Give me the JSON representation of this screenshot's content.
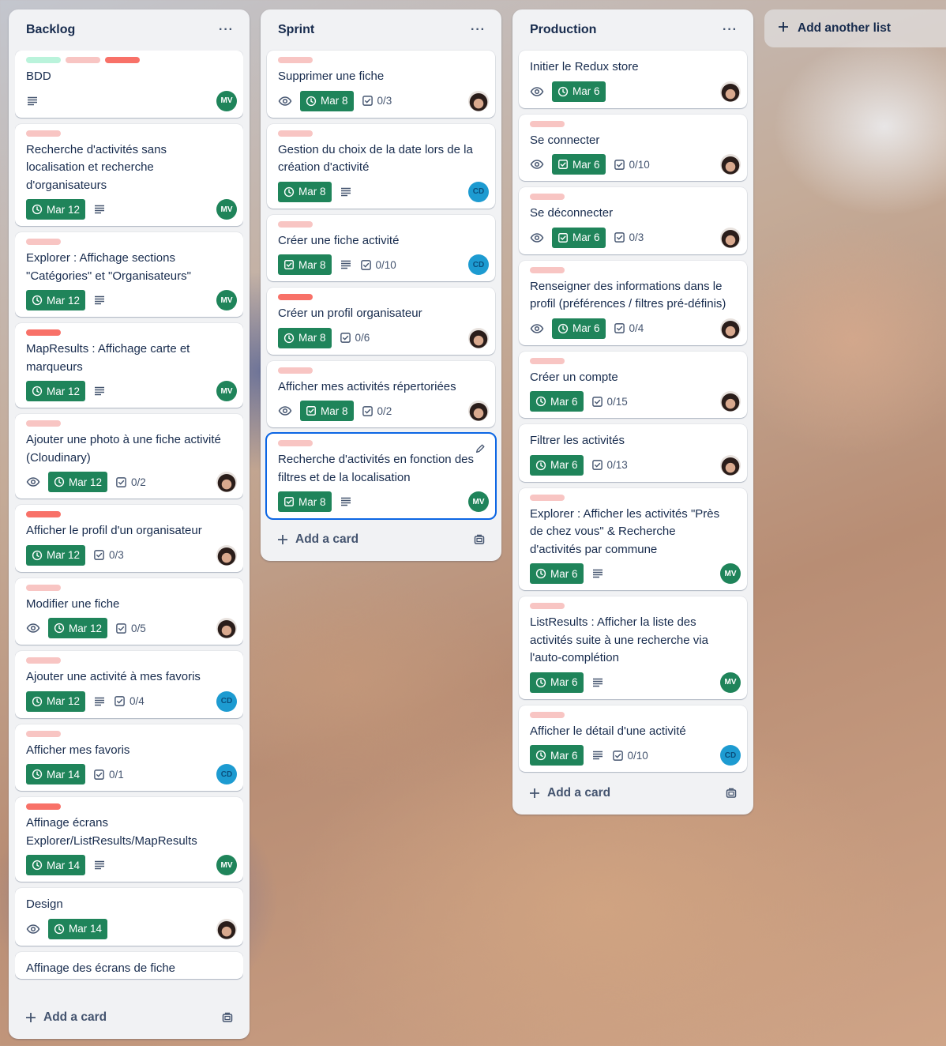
{
  "colors": {
    "label_light_pink": "#f8c5c3",
    "label_red": "#f87168",
    "label_green": "#baf3db",
    "due_green": "#1f845a",
    "avatar_mv": "#1f845a",
    "avatar_cd": "#1d9bd1",
    "selected_outline": "#0c66e4"
  },
  "board": {
    "add_another_list": "Add another list",
    "lists": [
      {
        "title": "Backlog",
        "menu": "···",
        "add_card": "Add a card",
        "cards": [
          {
            "labels": [
              "green",
              "light_pink",
              "red"
            ],
            "title": "BDD",
            "description": true,
            "avatar": "MV"
          },
          {
            "labels": [
              "light_pink"
            ],
            "title": "Recherche d'activités sans localisation et recherche d'organisateurs",
            "due": "Mar 12",
            "description": true,
            "avatar": "MV"
          },
          {
            "labels": [
              "light_pink"
            ],
            "title": "Explorer : Affichage sections \"Catégories\" et \"Organisateurs\"",
            "due": "Mar 12",
            "description": true,
            "avatar": "MV"
          },
          {
            "labels": [
              "red"
            ],
            "title": "MapResults : Affichage carte et marqueurs",
            "due": "Mar 12",
            "description": true,
            "avatar": "MV"
          },
          {
            "labels": [
              "light_pink"
            ],
            "title": "Ajouter une photo à une fiche activité (Cloudinary)",
            "watch": true,
            "due": "Mar 12",
            "checklist": "0/2",
            "avatar": "photo"
          },
          {
            "labels": [
              "red"
            ],
            "title": "Afficher le profil d'un organisateur",
            "due": "Mar 12",
            "checklist": "0/3",
            "avatar": "photo"
          },
          {
            "labels": [
              "light_pink"
            ],
            "title": "Modifier une fiche",
            "watch": true,
            "due": "Mar 12",
            "checklist": "0/5",
            "avatar": "photo"
          },
          {
            "labels": [
              "light_pink"
            ],
            "title": "Ajouter une activité à mes favoris",
            "due": "Mar 12",
            "description": true,
            "checklist": "0/4",
            "avatar": "CD"
          },
          {
            "labels": [
              "light_pink"
            ],
            "title": "Afficher mes favoris",
            "due": "Mar 14",
            "checklist": "0/1",
            "avatar": "CD"
          },
          {
            "labels": [
              "red"
            ],
            "title": "Affinage écrans Explorer/ListResults/MapResults",
            "due": "Mar 14",
            "description": true,
            "avatar": "MV"
          },
          {
            "labels": [],
            "title": "Design",
            "watch": true,
            "due": "Mar 14",
            "avatar": "photo"
          },
          {
            "labels": [],
            "title": "Affinage des écrans de fiche",
            "cut": true
          }
        ]
      },
      {
        "title": "Sprint",
        "menu": "···",
        "add_card": "Add a card",
        "cards": [
          {
            "labels": [
              "light_pink"
            ],
            "title": "Supprimer une fiche",
            "watch": true,
            "due": "Mar 8",
            "due_icon": "clock",
            "checklist": "0/3",
            "avatar": "photo"
          },
          {
            "labels": [
              "light_pink"
            ],
            "title": "Gestion du choix de la date lors de la création d'activité",
            "due": "Mar 8",
            "due_icon": "clock",
            "description": true,
            "avatar": "CD"
          },
          {
            "labels": [
              "light_pink"
            ],
            "title": "Créer une fiche activité",
            "due": "Mar 8",
            "due_icon": "check",
            "description": true,
            "checklist": "0/10",
            "avatar": "CD"
          },
          {
            "labels": [
              "red"
            ],
            "title": "Créer un profil organisateur",
            "due": "Mar 8",
            "due_icon": "clock",
            "checklist": "0/6",
            "avatar": "photo"
          },
          {
            "labels": [
              "light_pink"
            ],
            "title": "Afficher mes activités répertoriées",
            "watch": true,
            "due": "Mar 8",
            "due_icon": "check",
            "checklist": "0/2",
            "avatar": "photo"
          },
          {
            "labels": [
              "light_pink"
            ],
            "title": "Recherche d'activités en fonction des filtres et de la localisation",
            "due": "Mar 8",
            "due_icon": "check",
            "description": true,
            "avatar": "MV",
            "selected": true
          }
        ]
      },
      {
        "title": "Production",
        "menu": "···",
        "add_card": "Add a card",
        "cards": [
          {
            "labels": [],
            "title": "Initier le Redux store",
            "watch": true,
            "due": "Mar 6",
            "due_icon": "clock",
            "avatar": "photo"
          },
          {
            "labels": [
              "light_pink"
            ],
            "title": "Se connecter",
            "watch": true,
            "due": "Mar 6",
            "due_icon": "check",
            "checklist": "0/10",
            "avatar": "photo"
          },
          {
            "labels": [
              "light_pink"
            ],
            "title": "Se déconnecter",
            "watch": true,
            "due": "Mar 6",
            "due_icon": "check",
            "checklist": "0/3",
            "avatar": "photo"
          },
          {
            "labels": [
              "light_pink"
            ],
            "title": "Renseigner des informations dans le profil (préférences / filtres pré-définis)",
            "watch": true,
            "due": "Mar 6",
            "due_icon": "clock",
            "checklist": "0/4",
            "avatar": "photo"
          },
          {
            "labels": [
              "light_pink"
            ],
            "title": "Créer un compte",
            "due": "Mar 6",
            "due_icon": "clock",
            "checklist": "0/15",
            "avatar": "photo"
          },
          {
            "labels": [],
            "title": "Filtrer les activités",
            "due": "Mar 6",
            "due_icon": "clock",
            "checklist": "0/13",
            "avatar": "photo"
          },
          {
            "labels": [
              "light_pink"
            ],
            "title": "Explorer : Afficher les activités \"Près de chez vous\" & Recherche d'activités par commune",
            "due": "Mar 6",
            "due_icon": "clock",
            "description": true,
            "avatar": "MV"
          },
          {
            "labels": [
              "light_pink"
            ],
            "title": "ListResults : Afficher la liste des activités suite à une recherche via l'auto-complétion",
            "due": "Mar 6",
            "due_icon": "clock",
            "description": true,
            "avatar": "MV"
          },
          {
            "labels": [
              "light_pink"
            ],
            "title": "Afficher le détail d'une activité",
            "due": "Mar 6",
            "due_icon": "clock",
            "description": true,
            "checklist": "0/10",
            "avatar": "CD"
          }
        ]
      }
    ]
  }
}
